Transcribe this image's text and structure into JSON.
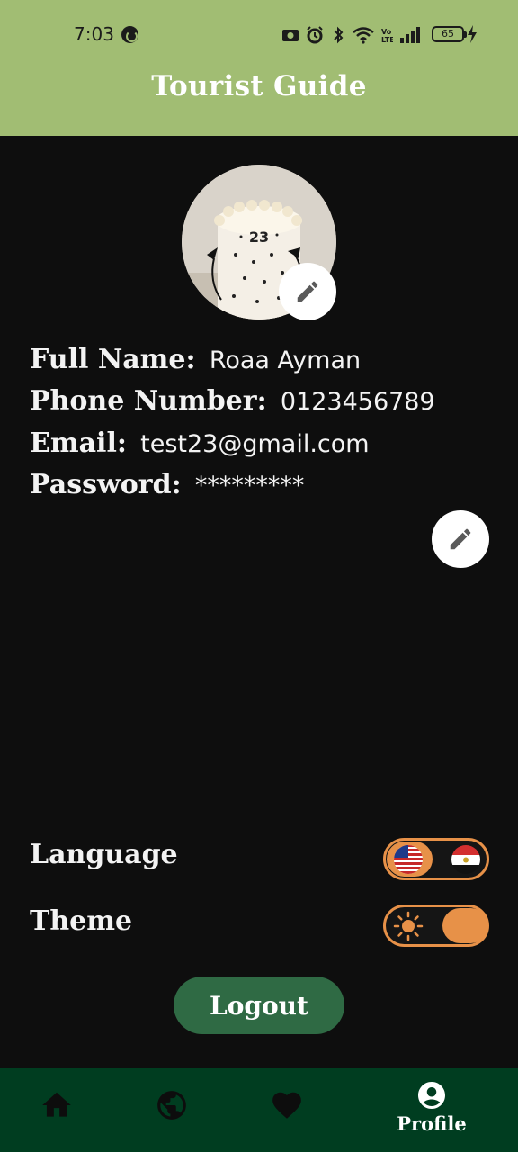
{
  "status_bar": {
    "time": "7:03",
    "battery": "65"
  },
  "app_bar": {
    "title": "Tourist Guide"
  },
  "profile": {
    "avatar_caption": "23",
    "full_name_label": "Full Name:",
    "full_name": "Roaa Ayman",
    "phone_label": "Phone Number:",
    "phone": "0123456789",
    "email_label": "Email:",
    "email": "test23@gmail.com",
    "password_label": "Password:",
    "password": "*********"
  },
  "settings": {
    "language_label": "Language",
    "theme_label": "Theme",
    "language_selected": "English",
    "theme_selected": "dark"
  },
  "actions": {
    "logout_label": "Logout"
  },
  "bottom_nav": {
    "items": [
      {
        "icon": "home-icon",
        "label": ""
      },
      {
        "icon": "globe-icon",
        "label": ""
      },
      {
        "icon": "heart-icon",
        "label": ""
      },
      {
        "icon": "account-circle-icon",
        "label": "Profile"
      }
    ]
  },
  "colors": {
    "app_bar": "#a1bd73",
    "background": "#0e0e0e",
    "accent": "#e79148",
    "logout_button": "#2f6a44",
    "bottom_nav": "#003d20"
  }
}
